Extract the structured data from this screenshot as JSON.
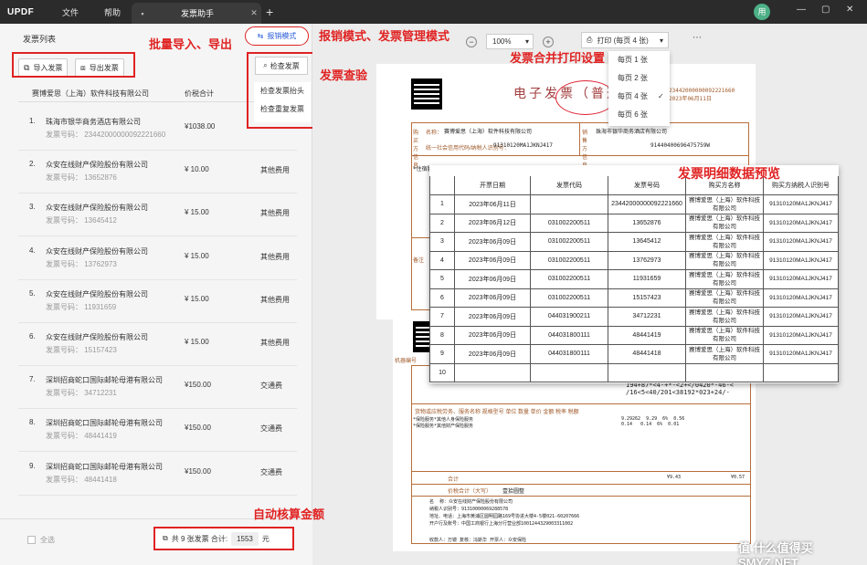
{
  "titlebar": {
    "logo": "UPDF",
    "menu_file": "文件",
    "menu_help": "帮助",
    "tab_title": "发票助手",
    "avatar": "用",
    "minimize": "—",
    "maximize": "▢",
    "close": "✕"
  },
  "left_panel": {
    "title": "发票列表",
    "import_label": "导入发票",
    "export_label": "导出发票",
    "mode_label": "报销模式",
    "check_label": "检查发票",
    "check_menu": [
      "检查发票抬头",
      "检查重复发票"
    ],
    "header_company": "赛博爱思（上海）软件科技有限公司",
    "header_amount": "价税合计",
    "rows": [
      {
        "n": "1.",
        "company": "珠海市银华商务酒店有限公司",
        "no": "发票号码：  23442000000092221660",
        "amount": "¥1038.00",
        "type": ""
      },
      {
        "n": "2.",
        "company": "众安在线财产保险股份有限公司",
        "no": "发票号码：  13652876",
        "amount": "¥ 10.00",
        "type": "其他费用"
      },
      {
        "n": "3.",
        "company": "众安在线财产保险股份有限公司",
        "no": "发票号码：  13645412",
        "amount": "¥ 15.00",
        "type": "其他费用"
      },
      {
        "n": "4.",
        "company": "众安在线财产保险股份有限公司",
        "no": "发票号码：  13762973",
        "amount": "¥ 15.00",
        "type": "其他费用"
      },
      {
        "n": "5.",
        "company": "众安在线财产保险股份有限公司",
        "no": "发票号码：  11931659",
        "amount": "¥ 15.00",
        "type": "其他费用"
      },
      {
        "n": "6.",
        "company": "众安在线财产保险股份有限公司",
        "no": "发票号码：  15157423",
        "amount": "¥ 15.00",
        "type": "其他费用"
      },
      {
        "n": "7.",
        "company": "深圳招商蛇口国际邮轮母港有限公司",
        "no": "发票号码：  34712231",
        "amount": "¥150.00",
        "type": "交通费"
      },
      {
        "n": "8.",
        "company": "深圳招商蛇口国际邮轮母港有限公司",
        "no": "发票号码：  48441419",
        "amount": "¥150.00",
        "type": "交通费"
      },
      {
        "n": "9.",
        "company": "深圳招商蛇口国际邮轮母港有限公司",
        "no": "发票号码：  48441418",
        "amount": "¥150.00",
        "type": "交通费"
      }
    ],
    "select_all": "全选",
    "total_prefix": "共 9 张发票  合计:",
    "total_value": "1553",
    "total_unit": "元"
  },
  "toolbar": {
    "zoom_minus": "−",
    "zoom_value": "100%",
    "zoom_plus": "+",
    "print_label": "打印 (每页 4 张)",
    "more": "⋯"
  },
  "print_dropdown": [
    "每页 1 张",
    "每页 2 张",
    "每页 4 张",
    "每页 6 张"
  ],
  "print_dropdown_checked": "✓",
  "annotations": {
    "batch": "批量导入、导出",
    "mode": "报销模式、发票管理模式",
    "check": "发票查验",
    "print": "发票合并打印设置",
    "preview": "发票明细数据预览",
    "auto": "自动核算金额"
  },
  "invoice1": {
    "title": "电子发票（普通发票）",
    "right_info": "23442000000092221660\n2023年06月11日",
    "buyer_name": "赛博爱思（上海）软件科技有限公司",
    "buyer_tax": "91310120MA1JKNJ417",
    "seller_name": "珠海市银华商务酒店有限公司",
    "seller_tax": "91440400696475759W",
    "label_buyer": "购买方信息",
    "label_seller": "销售方信息",
    "label_code": "统一社会信用代码/纳税人识别号：",
    "label_name": "名称：",
    "label_project": "*住宿服务",
    "label_remark": "备注"
  },
  "invoice2": {
    "machine_no": "机器编号",
    "cipher": "194+87*<4-+*-<2+</0420*-46-<\n/16<5<40/201<38192*023+24/-",
    "items": "*保险服务*其他人身保险服务\n*保险服务*其他财产保险服务",
    "amounts": "9.29262  9.29  6%  0.56\n0.14   0.14  6%  0.01",
    "total": "¥9.43",
    "total2": "¥0.57",
    "seller_block": "名  称：众安在线财产保险股份有限公司\n纳税人识别号：91310000069288578\n地址、电话：上海市黄浦区圆明园路169号协进大楼4-5楼021-60207666\n开户行及账号：中国工商银行上海分行营业部1001244329003311002",
    "footer": "收款人：万镜    复核：冯斯华    开票人：众安保险",
    "label_amount_cn": "价税合计（大写）",
    "label_amount_cn_value": "壹拾圆整",
    "header_cols": "货物或应税劳务、服务名称   规格型号   单位   数量   单价   金额   税率   税额",
    "sum_label": "合计"
  },
  "preview_table": {
    "headers": [
      "",
      "开票日期",
      "发票代码",
      "发票号码",
      "购买方名称",
      "购买方纳税人识别号"
    ],
    "rows": [
      [
        "1",
        "2023年06月11日",
        "",
        "23442000000092221660",
        "赛博爱思（上海）软件科技有限公司",
        "91310120MA1JKNJ417"
      ],
      [
        "2",
        "2023年06月12日",
        "031002200511",
        "13652876",
        "赛博爱思（上海）软件科技有限公司",
        "91310120MA1JKNJ417"
      ],
      [
        "3",
        "2023年06月09日",
        "031002200511",
        "13645412",
        "赛博爱思（上海）软件科技有限公司",
        "91310120MA1JKNJ417"
      ],
      [
        "4",
        "2023年06月09日",
        "031002200511",
        "13762973",
        "赛博爱思（上海）软件科技有限公司",
        "91310120MA1JKNJ417"
      ],
      [
        "5",
        "2023年06月09日",
        "031002200511",
        "11931659",
        "赛博爱思（上海）软件科技有限公司",
        "91310120MA1JKNJ417"
      ],
      [
        "6",
        "2023年06月09日",
        "031002200511",
        "15157423",
        "赛博爱思（上海）软件科技有限公司",
        "91310120MA1JKNJ417"
      ],
      [
        "7",
        "2023年06月09日",
        "044031900211",
        "34712231",
        "赛博爱思（上海）软件科技有限公司",
        "91310120MA1JKNJ417"
      ],
      [
        "8",
        "2023年06月09日",
        "044031800111",
        "48441419",
        "赛博爱思（上海）软件科技有限公司",
        "91310120MA1JKNJ417"
      ],
      [
        "9",
        "2023年06月09日",
        "044031800111",
        "48441418",
        "赛博爱思（上海）软件科技有限公司",
        "91310120MA1JKNJ417"
      ],
      [
        "10",
        "",
        "",
        "",
        "",
        ""
      ]
    ]
  },
  "watermark": "值 什么值得买 SMYZ.NET",
  "colors": {
    "annotation_red": "#e02222",
    "link_blue": "#2a5cd8",
    "invoice_brown": "#b86f3c"
  }
}
